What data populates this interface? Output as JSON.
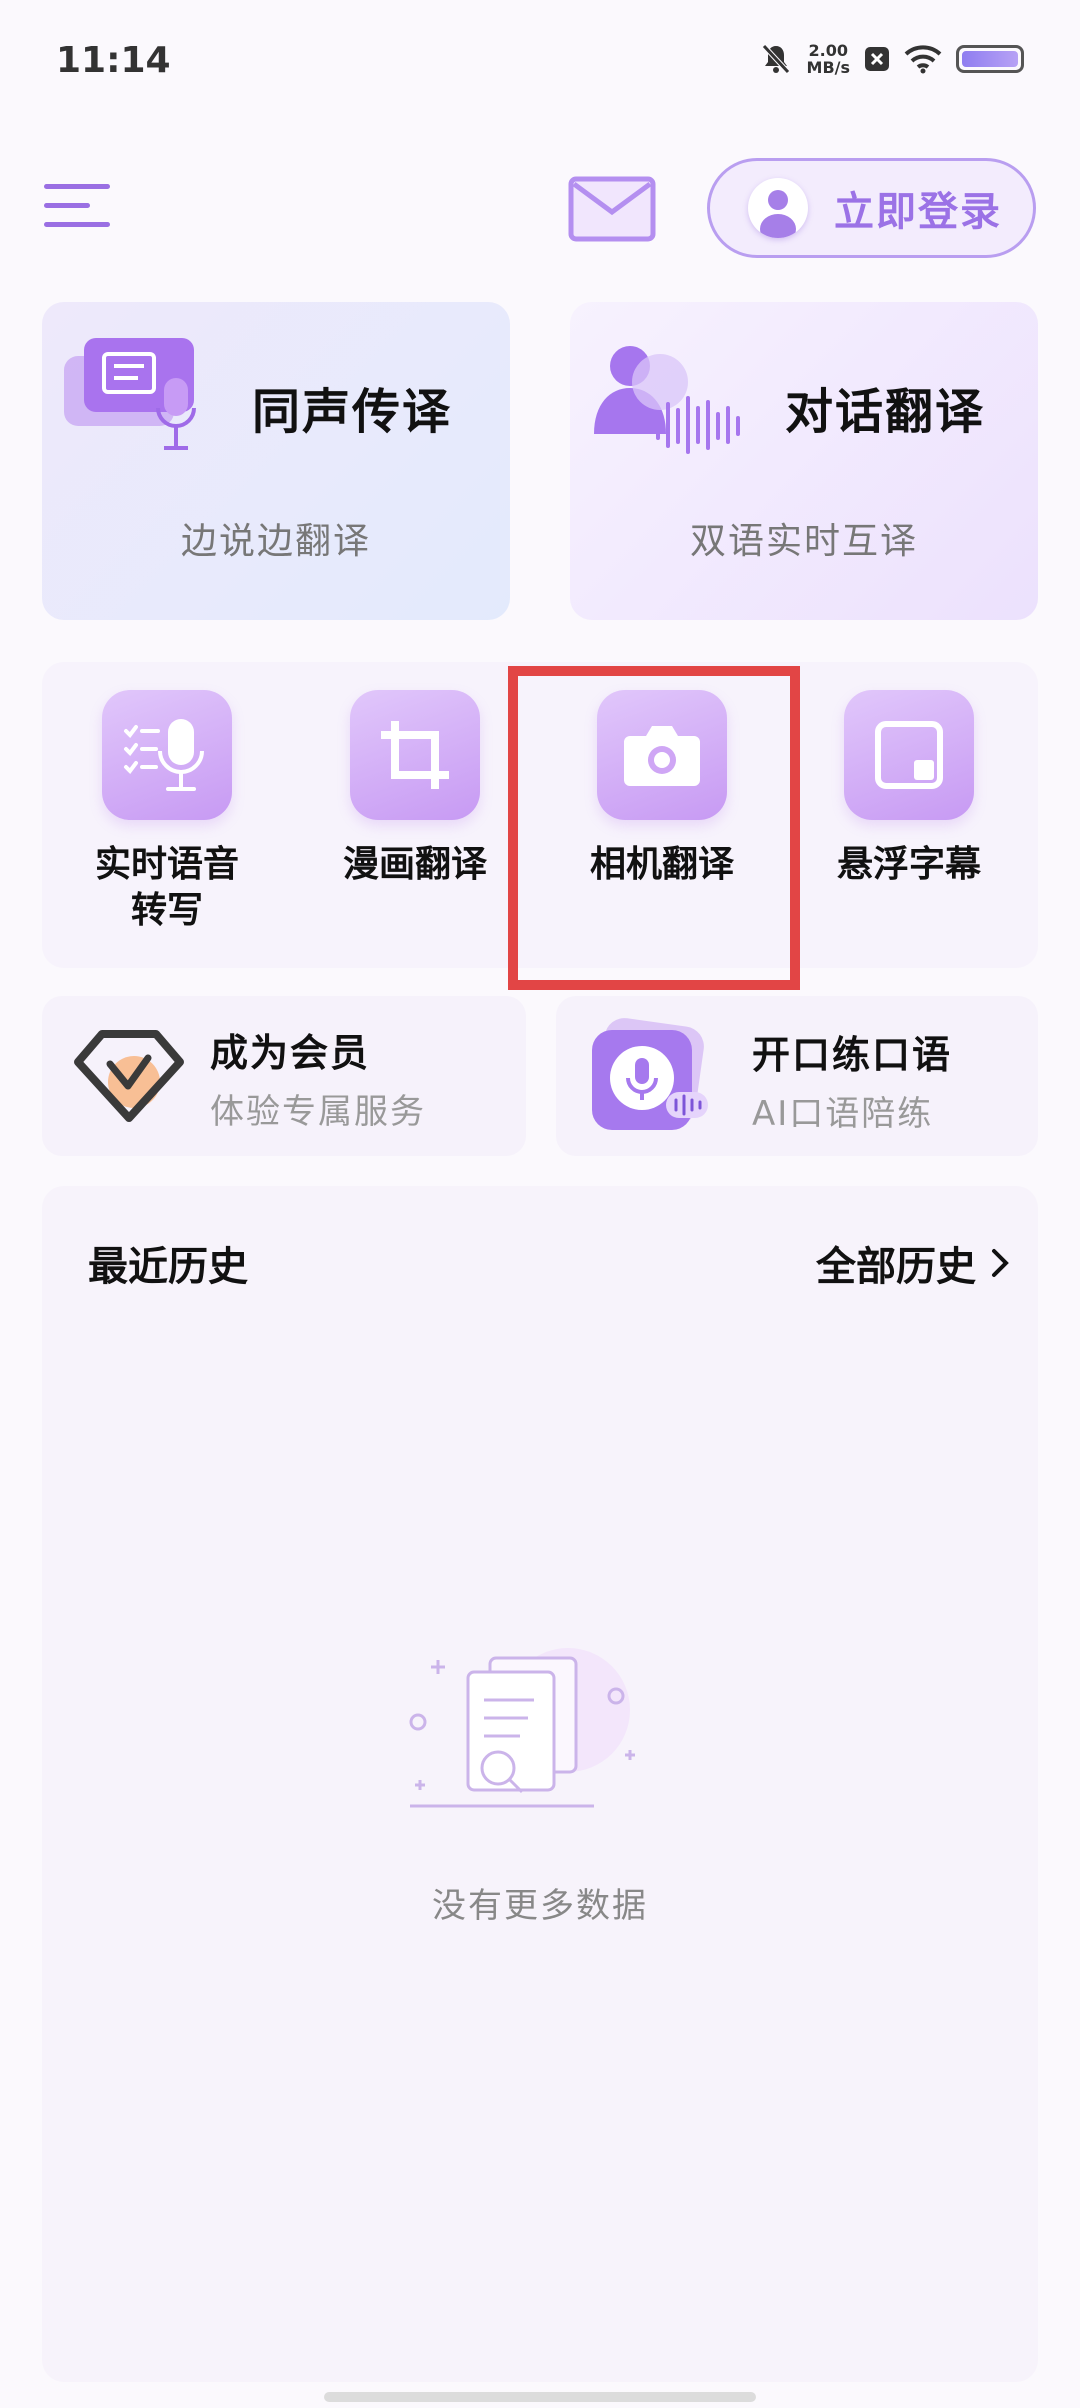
{
  "status_bar": {
    "time": "11:14",
    "speed_value": "2.00",
    "speed_unit": "MB/s"
  },
  "header": {
    "login_label": "立即登录"
  },
  "feature_cards": [
    {
      "title": "同声传译",
      "subtitle": "边说边翻译"
    },
    {
      "title": "对话翻译",
      "subtitle": "双语实时互译"
    }
  ],
  "tools": [
    {
      "label": "实时语音\n转写",
      "icon": "mic-list-icon"
    },
    {
      "label": "漫画翻译",
      "icon": "crop-icon"
    },
    {
      "label": "相机翻译",
      "icon": "camera-icon"
    },
    {
      "label": "悬浮字幕",
      "icon": "floating-window-icon"
    }
  ],
  "promo_cards": [
    {
      "title": "成为会员",
      "subtitle": "体验专属服务",
      "icon": "vip-diamond-icon"
    },
    {
      "title": "开口练口语",
      "subtitle": "AI口语陪练",
      "icon": "oral-practice-icon"
    }
  ],
  "history": {
    "title": "最近历史",
    "all_label": "全部历史",
    "empty_text": "没有更多数据"
  },
  "colors": {
    "accent": "#9b72e6",
    "highlight_border": "#e24545",
    "background": "#fbf9fd"
  }
}
